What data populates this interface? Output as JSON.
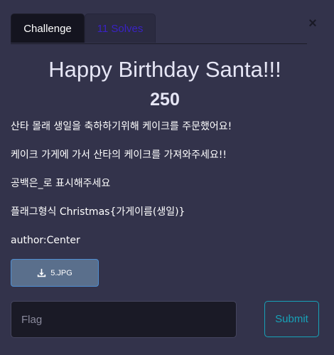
{
  "tabs": {
    "challenge": "Challenge",
    "solves": "11 Solves"
  },
  "close_label": "×",
  "challenge": {
    "name": "Happy Birthday Santa!!!",
    "value": "250",
    "description": [
      "산타 몰래 생일을 축하하기위해 케이크를 주문했어요!",
      "케이크 가게에 가서 산타의 케이크를 가져와주세요!!",
      "공백은_로 표시해주세요",
      "플래그형식 Christmas{가게이름(생일)}",
      "author:Center"
    ],
    "file_name": "5.JPG"
  },
  "form": {
    "flag_placeholder": "Flag",
    "submit_label": "Submit"
  },
  "icons": {
    "download": "download-icon",
    "close": "close-icon"
  },
  "colors": {
    "background": "#33334b",
    "tab_active": "#14141f",
    "solves_text": "#3a22c4",
    "file_button": "#5a6f8c",
    "submit_accent": "#17a2b8"
  }
}
